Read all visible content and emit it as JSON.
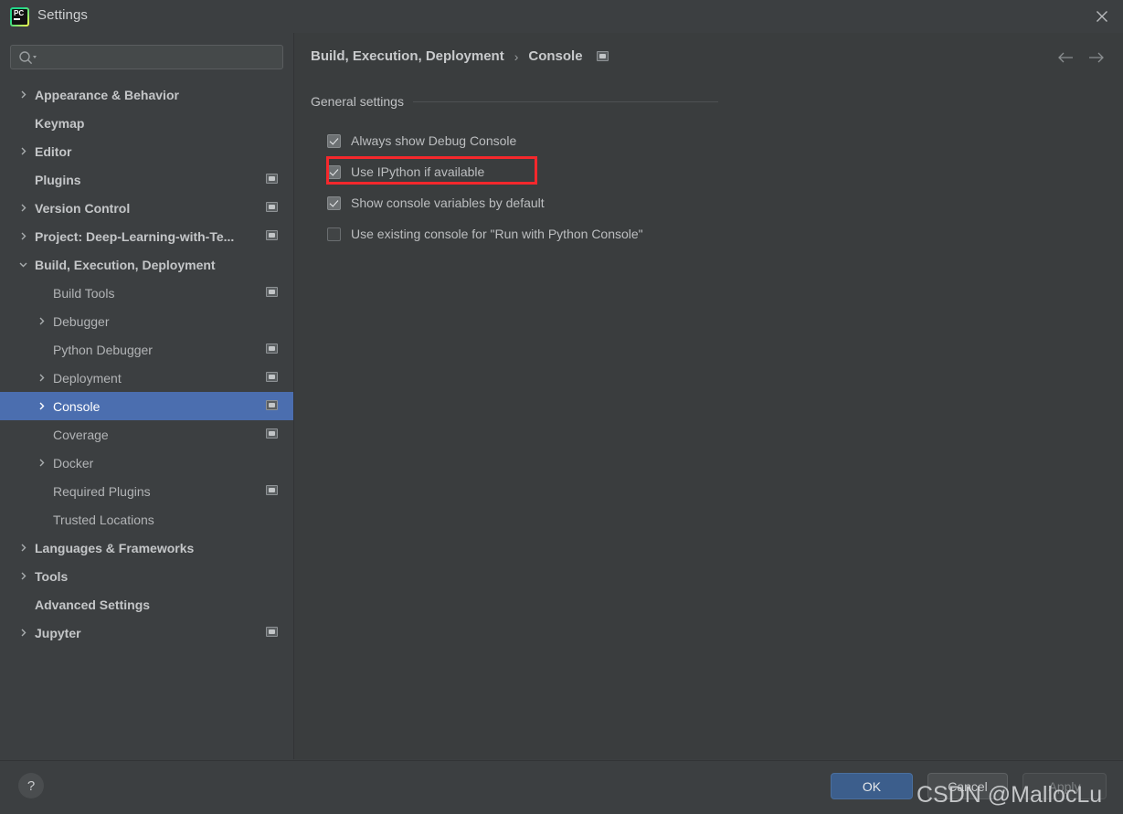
{
  "window": {
    "title": "Settings",
    "logo_icon": "pycharm-logo-icon",
    "close_icon": "close-icon"
  },
  "colors": {
    "window_bg": "#3c3f41",
    "content_bg": "#3a3d3e",
    "selection_blue": "#4b6eaf",
    "ok_button_blue": "#3c5e8c",
    "annotation_red": "#f5282c",
    "text_primary": "#c4c6c8",
    "text_secondary": "#b2b4b6"
  },
  "search": {
    "value": "",
    "placeholder": "",
    "icon": "search-icon",
    "dropdown_icon": "chevron-down-icon"
  },
  "sidebar": {
    "items": [
      {
        "label": "Appearance & Behavior",
        "level": 0,
        "expandable": true,
        "expanded": false,
        "scope_icon": false,
        "selected": false
      },
      {
        "label": "Keymap",
        "level": 0,
        "expandable": false,
        "expanded": false,
        "scope_icon": false,
        "selected": false
      },
      {
        "label": "Editor",
        "level": 0,
        "expandable": true,
        "expanded": false,
        "scope_icon": false,
        "selected": false
      },
      {
        "label": "Plugins",
        "level": 0,
        "expandable": false,
        "expanded": false,
        "scope_icon": true,
        "selected": false
      },
      {
        "label": "Version Control",
        "level": 0,
        "expandable": true,
        "expanded": false,
        "scope_icon": true,
        "selected": false
      },
      {
        "label": "Project: Deep-Learning-with-Te...",
        "level": 0,
        "expandable": true,
        "expanded": false,
        "scope_icon": true,
        "selected": false
      },
      {
        "label": "Build, Execution, Deployment",
        "level": 0,
        "expandable": true,
        "expanded": true,
        "scope_icon": false,
        "selected": false
      },
      {
        "label": "Build Tools",
        "level": 1,
        "expandable": false,
        "expanded": false,
        "scope_icon": true,
        "selected": false
      },
      {
        "label": "Debugger",
        "level": 1,
        "expandable": true,
        "expanded": false,
        "scope_icon": false,
        "selected": false
      },
      {
        "label": "Python Debugger",
        "level": 1,
        "expandable": false,
        "expanded": false,
        "scope_icon": true,
        "selected": false
      },
      {
        "label": "Deployment",
        "level": 1,
        "expandable": true,
        "expanded": false,
        "scope_icon": true,
        "selected": false
      },
      {
        "label": "Console",
        "level": 1,
        "expandable": true,
        "expanded": false,
        "scope_icon": true,
        "selected": true
      },
      {
        "label": "Coverage",
        "level": 1,
        "expandable": false,
        "expanded": false,
        "scope_icon": true,
        "selected": false
      },
      {
        "label": "Docker",
        "level": 1,
        "expandable": true,
        "expanded": false,
        "scope_icon": false,
        "selected": false
      },
      {
        "label": "Required Plugins",
        "level": 1,
        "expandable": false,
        "expanded": false,
        "scope_icon": true,
        "selected": false
      },
      {
        "label": "Trusted Locations",
        "level": 1,
        "expandable": false,
        "expanded": false,
        "scope_icon": false,
        "selected": false
      },
      {
        "label": "Languages & Frameworks",
        "level": 0,
        "expandable": true,
        "expanded": false,
        "scope_icon": false,
        "selected": false
      },
      {
        "label": "Tools",
        "level": 0,
        "expandable": true,
        "expanded": false,
        "scope_icon": false,
        "selected": false
      },
      {
        "label": "Advanced Settings",
        "level": 0,
        "expandable": false,
        "expanded": false,
        "scope_icon": false,
        "selected": false
      },
      {
        "label": "Jupyter",
        "level": 0,
        "expandable": true,
        "expanded": false,
        "scope_icon": true,
        "selected": false
      }
    ]
  },
  "content": {
    "breadcrumb": {
      "parent": "Build, Execution, Deployment",
      "separator": "›",
      "current": "Console",
      "scope_icon": "project-scope-icon"
    },
    "nav": {
      "back_icon": "arrow-left-icon",
      "forward_icon": "arrow-right-icon"
    },
    "section_title": "General settings",
    "options": [
      {
        "label": "Always show Debug Console",
        "checked": true,
        "highlighted": false
      },
      {
        "label": "Use IPython if available",
        "checked": true,
        "highlighted": true
      },
      {
        "label": "Show console variables by default",
        "checked": true,
        "highlighted": false
      },
      {
        "label": "Use existing console for \"Run with Python Console\"",
        "checked": false,
        "highlighted": false
      }
    ]
  },
  "footer": {
    "help_label": "?",
    "ok_label": "OK",
    "cancel_label": "Cancel",
    "apply_label": "Apply",
    "apply_disabled": true
  },
  "watermark": "CSDN @MallocLu"
}
